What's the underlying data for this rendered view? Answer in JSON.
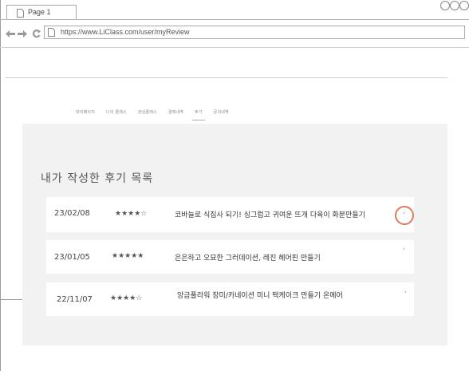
{
  "browser": {
    "tab_title": "Page 1",
    "url": "https://www.LiClass.com/user/myReview"
  },
  "nav": {
    "items": [
      {
        "label": "마이페이지"
      },
      {
        "label": "나의 클래스"
      },
      {
        "label": "관심클래스"
      },
      {
        "label": "결제내역"
      },
      {
        "label": "후기",
        "active": true
      },
      {
        "label": "문의내역"
      }
    ]
  },
  "page": {
    "title": "내가 작성한 후기 목록"
  },
  "reviews": [
    {
      "date": "23/02/08",
      "stars": "★★★★☆",
      "title": "코바늘로 식집사 되기! 싱그럽고 귀여운 뜨개 다육이 화분만들기",
      "arrow": "›",
      "highlighted": true
    },
    {
      "date": "23/01/05",
      "stars": "★★★★★",
      "title": "은은하고 오묘한 그러데이션, 레진 헤어핀 만들기",
      "arrow": "›",
      "highlighted": false
    },
    {
      "date": "22/11/07",
      "stars": "★★★★☆",
      "title": "앙금플라워 장미/카네이션 미니 떡케이크 만들기 온메어",
      "arrow": "›",
      "highlighted": false
    }
  ],
  "colors": {
    "panel_bg": "#f2f2f2",
    "highlight_circle": "#e07a5f"
  }
}
